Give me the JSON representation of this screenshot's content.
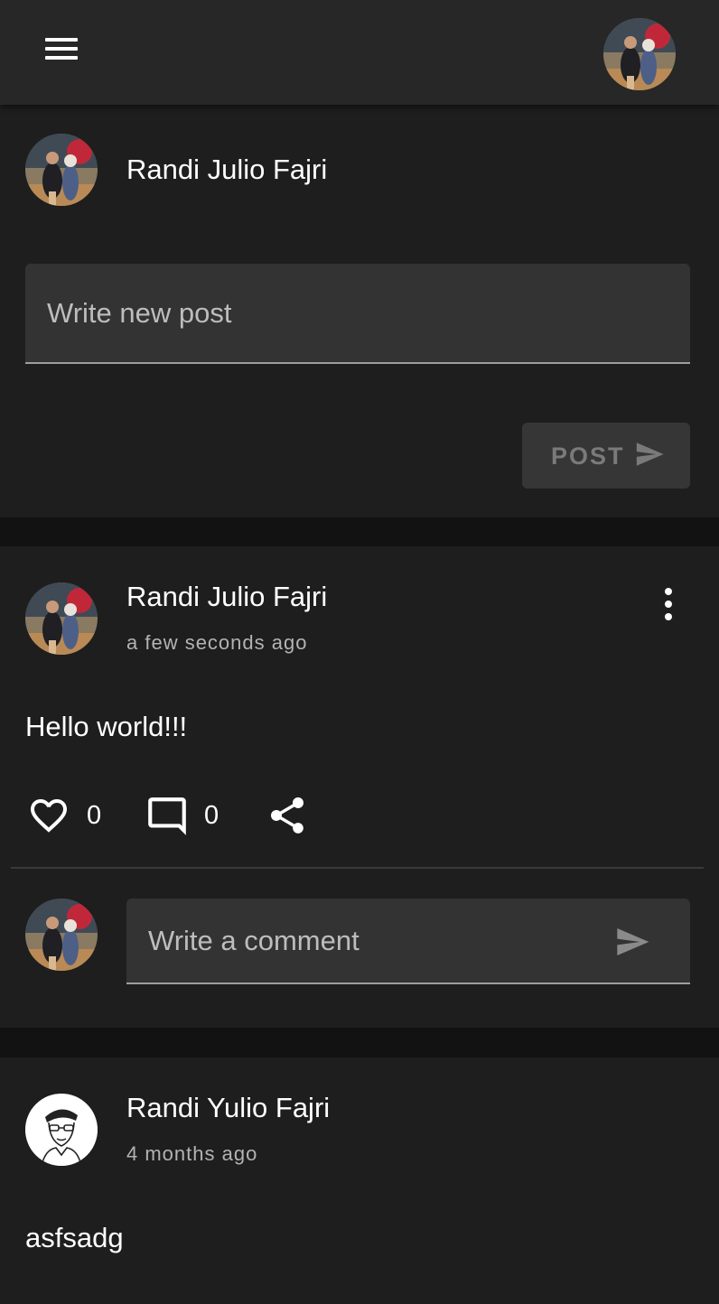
{
  "composer": {
    "user_name": "Randi Julio Fajri",
    "placeholder": "Write new post",
    "post_label": "POST"
  },
  "feed": [
    {
      "author": "Randi Julio Fajri",
      "time": "a few seconds ago",
      "content": "Hello world!!!",
      "likes": "0",
      "comments": "0",
      "comment_placeholder": "Write a comment"
    },
    {
      "author": "Randi Yulio Fajri",
      "time": "4 months ago",
      "content": "asfsadg"
    }
  ],
  "icons": {
    "menu": "menu-icon",
    "more": "more-vert-icon",
    "like": "heart-outline-icon",
    "comment": "comment-icon",
    "share": "share-icon",
    "send": "send-icon"
  },
  "colors": {
    "appbar": "#272727",
    "card": "#1e1e1e",
    "background": "#121212",
    "field": "#333333",
    "secondary_text": "#b3b3b3"
  }
}
